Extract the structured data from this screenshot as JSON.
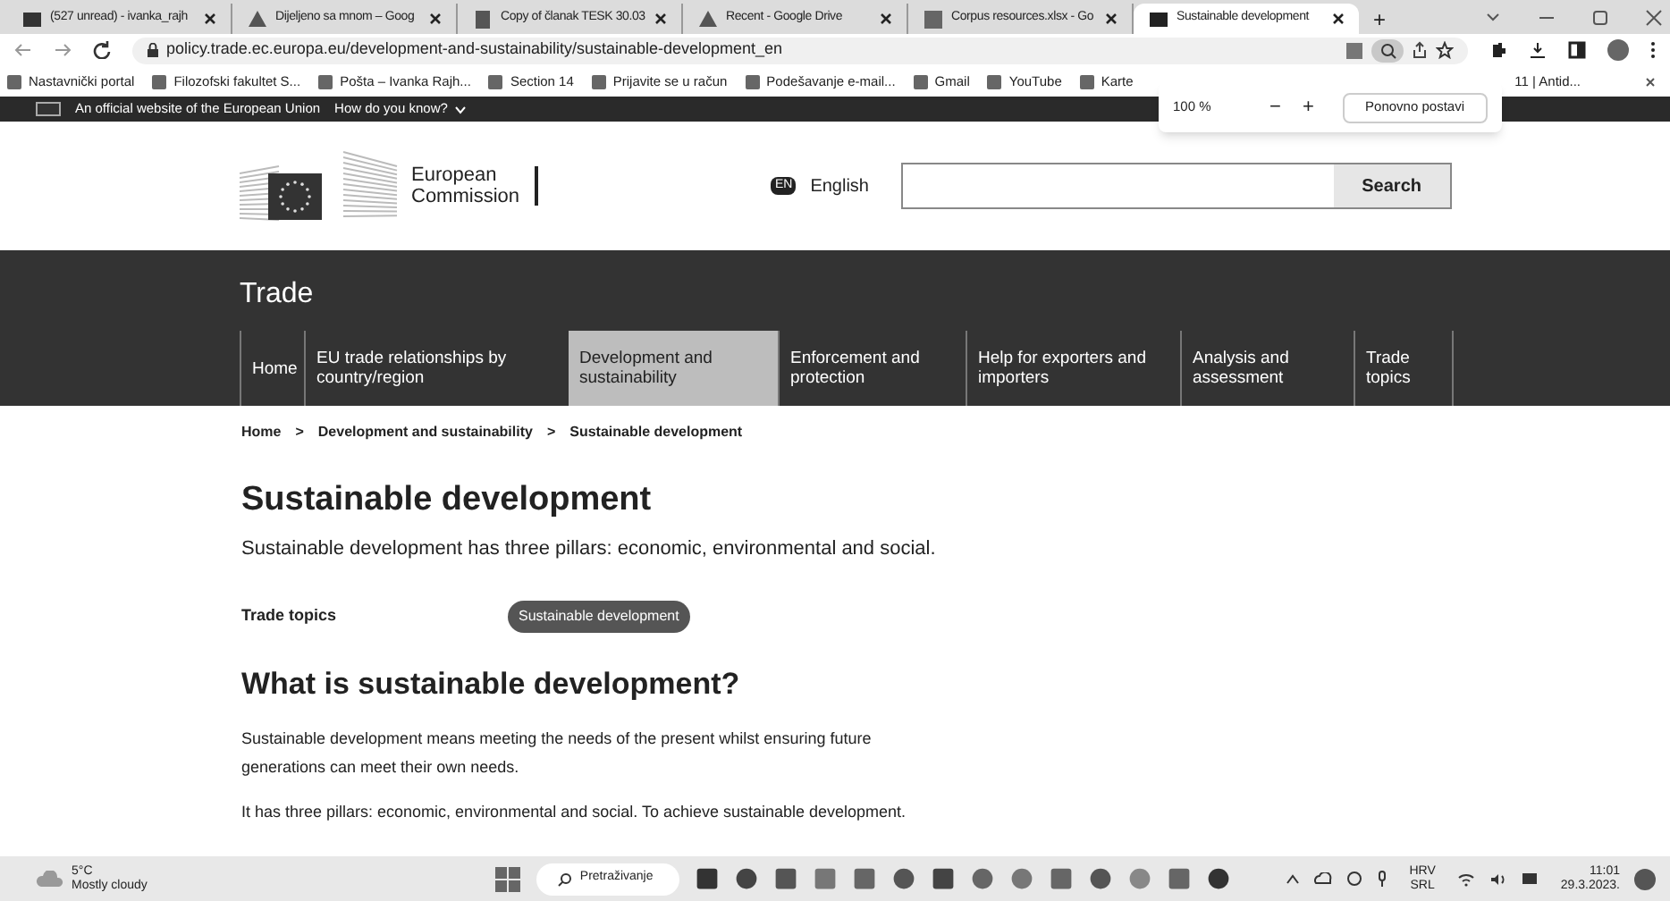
{
  "browser": {
    "tabs": [
      {
        "title": "(527 unread) - ivanka_rajh",
        "selected": false
      },
      {
        "title": "Dijeljeno sa mnom – Goog",
        "selected": false
      },
      {
        "title": "Copy of članak TESK 30.03",
        "selected": false
      },
      {
        "title": "Recent - Google Drive",
        "selected": false
      },
      {
        "title": "Corpus resources.xlsx - Go",
        "selected": false
      },
      {
        "title": "Sustainable development",
        "selected": true
      }
    ],
    "new_tab": "+",
    "url": "policy.trade.ec.europa.eu/development-and-sustainability/sustainable-development_en",
    "bookmarks": [
      "Nastavnički portal",
      "Filozofski fakultet S...",
      "Pošta – Ivanka Rajh...",
      "Section 14",
      "Prijavite se u račun",
      "Podešavanje e-mail...",
      "Gmail",
      "YouTube",
      "Karte"
    ],
    "bookmark_after_popup": "11 | Antid...",
    "zoom_popup": {
      "value": "100 %",
      "minus": "−",
      "plus": "+",
      "reset": "Ponovno postavi"
    }
  },
  "eu_bar": {
    "text": "An official website of the European Union",
    "link": "How do you know?"
  },
  "header": {
    "logo_line1": "European",
    "logo_line2": "Commission",
    "language_code": "EN",
    "language": "English",
    "search_button": "Search"
  },
  "site": {
    "title": "Trade",
    "nav": [
      {
        "label": "Home",
        "selected": false
      },
      {
        "label": "EU trade relationships by country/region",
        "selected": false
      },
      {
        "label": "Development and sustainability",
        "selected": true
      },
      {
        "label": "Enforcement and protection",
        "selected": false
      },
      {
        "label": "Help for exporters and importers",
        "selected": false
      },
      {
        "label": "Analysis and assessment",
        "selected": false
      },
      {
        "label": "Trade topics",
        "selected": false
      }
    ]
  },
  "breadcrumb": [
    "Home",
    "Development and sustainability",
    "Sustainable development"
  ],
  "breadcrumb_separator": ">",
  "page": {
    "title": "Sustainable development",
    "intro": "Sustainable development has three pillars: economic, environmental and social.",
    "topics_label": "Trade topics",
    "topic_tag": "Sustainable development",
    "section_title": "What is sustainable development?",
    "paragraphs": [
      "Sustainable development means meeting the needs of the present whilst ensuring future generations can meet their own needs.",
      "It has three pillars: economic, environmental and social. To achieve sustainable development."
    ]
  },
  "taskbar": {
    "temperature": "5°C",
    "weather": "Mostly cloudy",
    "search": "Pretraživanje",
    "language": "HRV",
    "layout": "SRL",
    "time": "11:01",
    "date": "29.3.2023."
  }
}
